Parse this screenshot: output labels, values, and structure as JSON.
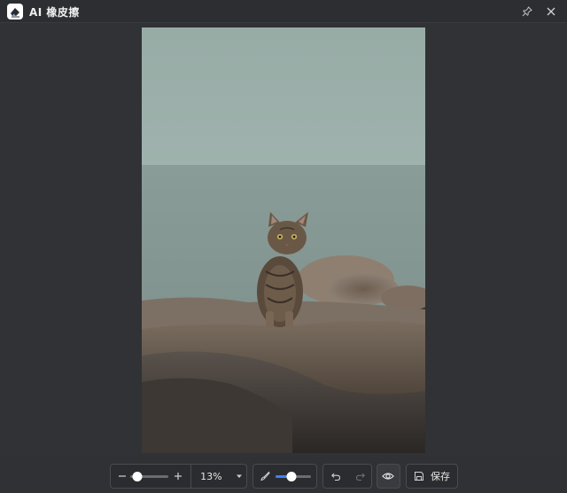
{
  "titlebar": {
    "title": "AI 橡皮擦",
    "icons": {
      "app": "eraser-app-icon",
      "pin": "pin-icon",
      "close": "close-icon"
    }
  },
  "canvas": {
    "image": "kitten-on-rocks-photo",
    "background": "#313235"
  },
  "toolbar": {
    "zoom": {
      "minus_icon": "zoom-out-icon",
      "plus_icon": "zoom-in-icon",
      "slider_level": 0.2,
      "value": "13%",
      "dropdown_icon": "caret-down-icon"
    },
    "brush": {
      "icon": "brush-icon",
      "size_level": 0.45
    },
    "undo_icon": "undo-icon",
    "redo_icon": "redo-icon",
    "preview_icon": "eye-icon",
    "save": {
      "icon": "save-icon",
      "label": "保存"
    },
    "accent_color": "#3b82f6"
  }
}
